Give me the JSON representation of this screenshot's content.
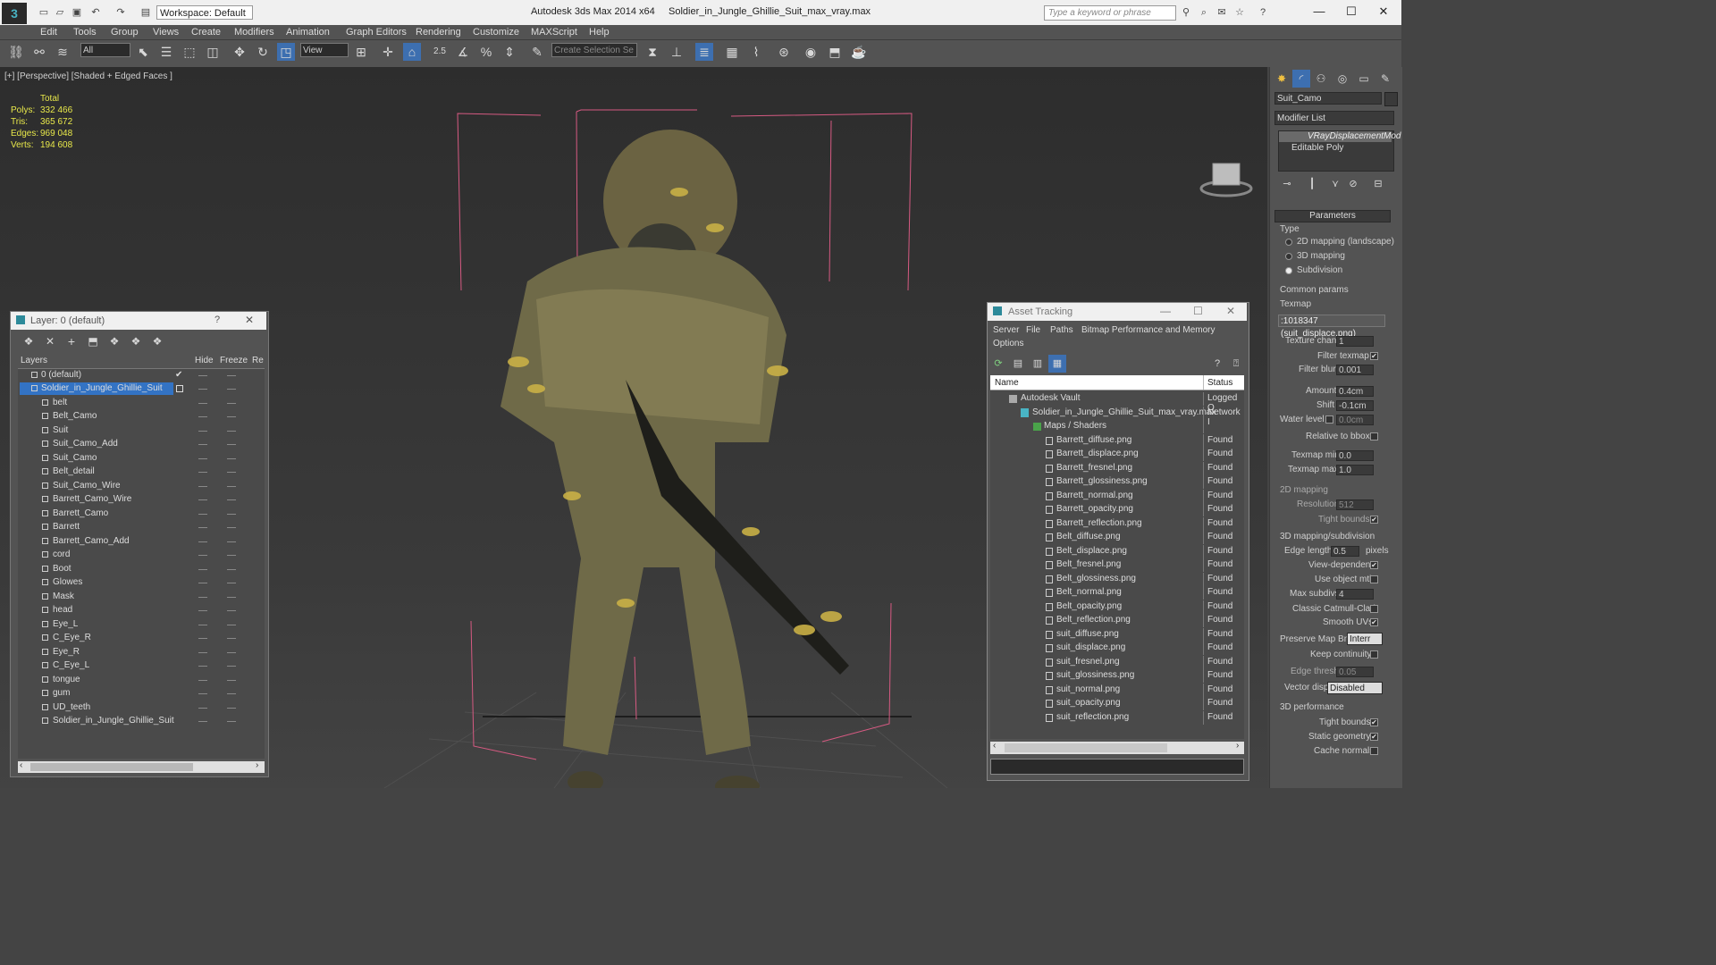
{
  "app": {
    "title": "Autodesk 3ds Max  2014 x64",
    "file": "Soldier_in_Jungle_Ghillie_Suit_max_vray.max",
    "workspace": "Workspace: Default",
    "search_placeholder": "Type a keyword or phrase"
  },
  "menu": [
    "Edit",
    "Tools",
    "Group",
    "Views",
    "Create",
    "Modifiers",
    "Animation",
    "Graph Editors",
    "Rendering",
    "Customize",
    "MAXScript",
    "Help"
  ],
  "toolbar": {
    "filter": "All",
    "coord": "View",
    "snap_angle": "2.5",
    "selection_set": "Create Selection Se"
  },
  "viewport": {
    "label": "[+] [Perspective] [Shaded + Edged Faces ]",
    "stats": {
      "header": "Total",
      "rows": [
        {
          "k": "Polys:",
          "v": "332 466"
        },
        {
          "k": "Tris:",
          "v": "365 672"
        },
        {
          "k": "Edges:",
          "v": "969 048"
        },
        {
          "k": "Verts:",
          "v": "194 608"
        }
      ]
    }
  },
  "layers": {
    "title": "Layer: 0 (default)",
    "help": "?",
    "columns": {
      "name": "Layers",
      "hide": "Hide",
      "freeze": "Freeze",
      "render": "Re"
    },
    "rows": [
      {
        "name": "0 (default)",
        "level": 0,
        "current": true
      },
      {
        "name": "Soldier_in_Jungle_Ghillie_Suit",
        "level": 0,
        "selected": true
      },
      {
        "name": "belt",
        "level": 1
      },
      {
        "name": "Belt_Camo",
        "level": 1
      },
      {
        "name": "Suit",
        "level": 1
      },
      {
        "name": "Suit_Camo_Add",
        "level": 1
      },
      {
        "name": "Suit_Camo",
        "level": 1
      },
      {
        "name": "Belt_detail",
        "level": 1
      },
      {
        "name": "Suit_Camo_Wire",
        "level": 1
      },
      {
        "name": "Barrett_Camo_Wire",
        "level": 1
      },
      {
        "name": "Barrett_Camo",
        "level": 1
      },
      {
        "name": "Barrett",
        "level": 1
      },
      {
        "name": "Barrett_Camo_Add",
        "level": 1
      },
      {
        "name": "cord",
        "level": 1
      },
      {
        "name": "Boot",
        "level": 1
      },
      {
        "name": "Glowes",
        "level": 1
      },
      {
        "name": "Mask",
        "level": 1
      },
      {
        "name": "head",
        "level": 1
      },
      {
        "name": "Eye_L",
        "level": 1
      },
      {
        "name": "C_Eye_R",
        "level": 1
      },
      {
        "name": "Eye_R",
        "level": 1
      },
      {
        "name": "C_Eye_L",
        "level": 1
      },
      {
        "name": "tongue",
        "level": 1
      },
      {
        "name": "gum",
        "level": 1
      },
      {
        "name": "UD_teeth",
        "level": 1
      },
      {
        "name": "Soldier_in_Jungle_Ghillie_Suit",
        "level": 1
      }
    ]
  },
  "asset_tracking": {
    "title": "Asset Tracking",
    "menu": [
      "Server",
      "File",
      "Paths",
      "Bitmap Performance and Memory",
      "Options"
    ],
    "columns": {
      "name": "Name",
      "status": "Status"
    },
    "rows": [
      {
        "name": "Autodesk Vault",
        "status": "Logged O",
        "indent": 1
      },
      {
        "name": "Soldier_in_Jungle_Ghillie_Suit_max_vray.max",
        "status": "Network I",
        "indent": 2
      },
      {
        "name": "Maps / Shaders",
        "status": "",
        "indent": 3
      },
      {
        "name": "Barrett_diffuse.png",
        "status": "Found",
        "indent": 4
      },
      {
        "name": "Barrett_displace.png",
        "status": "Found",
        "indent": 4
      },
      {
        "name": "Barrett_fresnel.png",
        "status": "Found",
        "indent": 4
      },
      {
        "name": "Barrett_glossiness.png",
        "status": "Found",
        "indent": 4
      },
      {
        "name": "Barrett_normal.png",
        "status": "Found",
        "indent": 4
      },
      {
        "name": "Barrett_opacity.png",
        "status": "Found",
        "indent": 4
      },
      {
        "name": "Barrett_reflection.png",
        "status": "Found",
        "indent": 4
      },
      {
        "name": "Belt_diffuse.png",
        "status": "Found",
        "indent": 4
      },
      {
        "name": "Belt_displace.png",
        "status": "Found",
        "indent": 4
      },
      {
        "name": "Belt_fresnel.png",
        "status": "Found",
        "indent": 4
      },
      {
        "name": "Belt_glossiness.png",
        "status": "Found",
        "indent": 4
      },
      {
        "name": "Belt_normal.png",
        "status": "Found",
        "indent": 4
      },
      {
        "name": "Belt_opacity.png",
        "status": "Found",
        "indent": 4
      },
      {
        "name": "Belt_reflection.png",
        "status": "Found",
        "indent": 4
      },
      {
        "name": "suit_diffuse.png",
        "status": "Found",
        "indent": 4
      },
      {
        "name": "suit_displace.png",
        "status": "Found",
        "indent": 4
      },
      {
        "name": "suit_fresnel.png",
        "status": "Found",
        "indent": 4
      },
      {
        "name": "suit_glossiness.png",
        "status": "Found",
        "indent": 4
      },
      {
        "name": "suit_normal.png",
        "status": "Found",
        "indent": 4
      },
      {
        "name": "suit_opacity.png",
        "status": "Found",
        "indent": 4
      },
      {
        "name": "suit_reflection.png",
        "status": "Found",
        "indent": 4
      }
    ]
  },
  "command_panel": {
    "object_name": "Suit_Camo",
    "modifier_list": "Modifier List",
    "stack": [
      "VRayDisplacementMod",
      "Editable Poly"
    ],
    "parameters": "Parameters",
    "type_label": "Type",
    "type_options": [
      "2D mapping (landscape)",
      "3D mapping",
      "Subdivision"
    ],
    "type_selected": 2,
    "common_params": "Common params",
    "texmap_label": "Texmap",
    "texmap_value": ":1018347 (suit_displace.png)",
    "texture_chan_label": "Texture chan",
    "texture_chan": "1",
    "filter_texmap_label": "Filter texmap",
    "filter_blur_label": "Filter blur",
    "filter_blur": "0.001",
    "amount_label": "Amount",
    "amount": "0.4cm",
    "shift_label": "Shift",
    "shift": "-0.1cm",
    "water_level_label": "Water level",
    "water_level": "0.0cm",
    "relative_bbox_label": "Relative to bbox",
    "texmap_min_label": "Texmap min",
    "texmap_min": "0.0",
    "texmap_max_label": "Texmap max",
    "texmap_max": "1.0",
    "mapping2d": "2D mapping",
    "resolution_label": "Resolution",
    "resolution": "512",
    "tight_bounds_label": "Tight bounds",
    "mapping3d": "3D mapping/subdivision",
    "edge_length_label": "Edge length",
    "edge_length": "0.5",
    "pixels_label": "pixels",
    "view_dependent_label": "View-dependent",
    "use_object_mtl_label": "Use object mtl",
    "max_subdivs_label": "Max subdivs",
    "max_subdivs": "4",
    "catmull_label": "Classic Catmull-Clark",
    "smooth_uvs_label": "Smooth UVs",
    "preserve_map_label": "Preserve Map Bnd",
    "preserve_map": "Interr",
    "keep_continuity_label": "Keep continuity",
    "edge_thresh_label": "Edge thresh",
    "edge_thresh": "0.05",
    "vector_displ_label": "Vector displ",
    "vector_displ": "Disabled",
    "perf3d": "3D performance",
    "tight_bounds2_label": "Tight bounds",
    "static_geometry_label": "Static geometry",
    "cache_normals_label": "Cache normals"
  }
}
